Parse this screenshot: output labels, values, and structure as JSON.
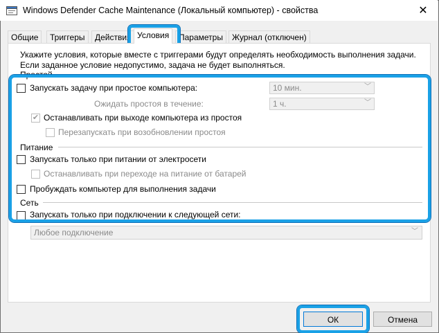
{
  "window": {
    "title": "Windows Defender Cache Maintenance (Локальный компьютер) - свойства",
    "close_glyph": "✕"
  },
  "tabs": [
    {
      "label": "Общие"
    },
    {
      "label": "Триггеры"
    },
    {
      "label": "Действия"
    },
    {
      "label": "Условия",
      "active": true
    },
    {
      "label": "Параметры"
    },
    {
      "label": "Журнал (отключен)"
    }
  ],
  "description": {
    "line1": "Укажите условия, которые вместе с триггерами будут определять необходимость выполнения задачи.",
    "line2": "Если заданное условие недопустимо, задача не будет выполняться."
  },
  "idle": {
    "heading": "Простой",
    "start_if_idle": {
      "label": "Запускать задачу при простое компьютера:",
      "checked": false,
      "select_value": "10 мин."
    },
    "wait_idle": {
      "label": "Ожидать простоя в течение:",
      "select_value": "1 ч."
    },
    "stop_on_idle_end": {
      "label": "Останавливать при выходе компьютера из простоя",
      "checked": true,
      "enabled": false
    },
    "restart_on_idle": {
      "label": "Перезапускать при возобновлении простоя",
      "checked": false,
      "enabled": false
    }
  },
  "power": {
    "heading": "Питание",
    "ac_only": {
      "label": "Запускать только при питании от электросети",
      "checked": false
    },
    "stop_on_battery": {
      "label": "Останавливать при переходе на питание от батарей",
      "checked": false,
      "enabled": false
    },
    "wake": {
      "label": "Пробуждать компьютер для выполнения задачи",
      "checked": false
    }
  },
  "network": {
    "heading": "Сеть",
    "network_only": {
      "label": "Запускать только при подключении к следующей сети:",
      "checked": false
    },
    "select_value": "Любое подключение"
  },
  "buttons": {
    "ok": "ОК",
    "cancel": "Отмена"
  },
  "colors": {
    "highlight": "#1aa1e6",
    "disabled_text": "#8a8a8a"
  }
}
